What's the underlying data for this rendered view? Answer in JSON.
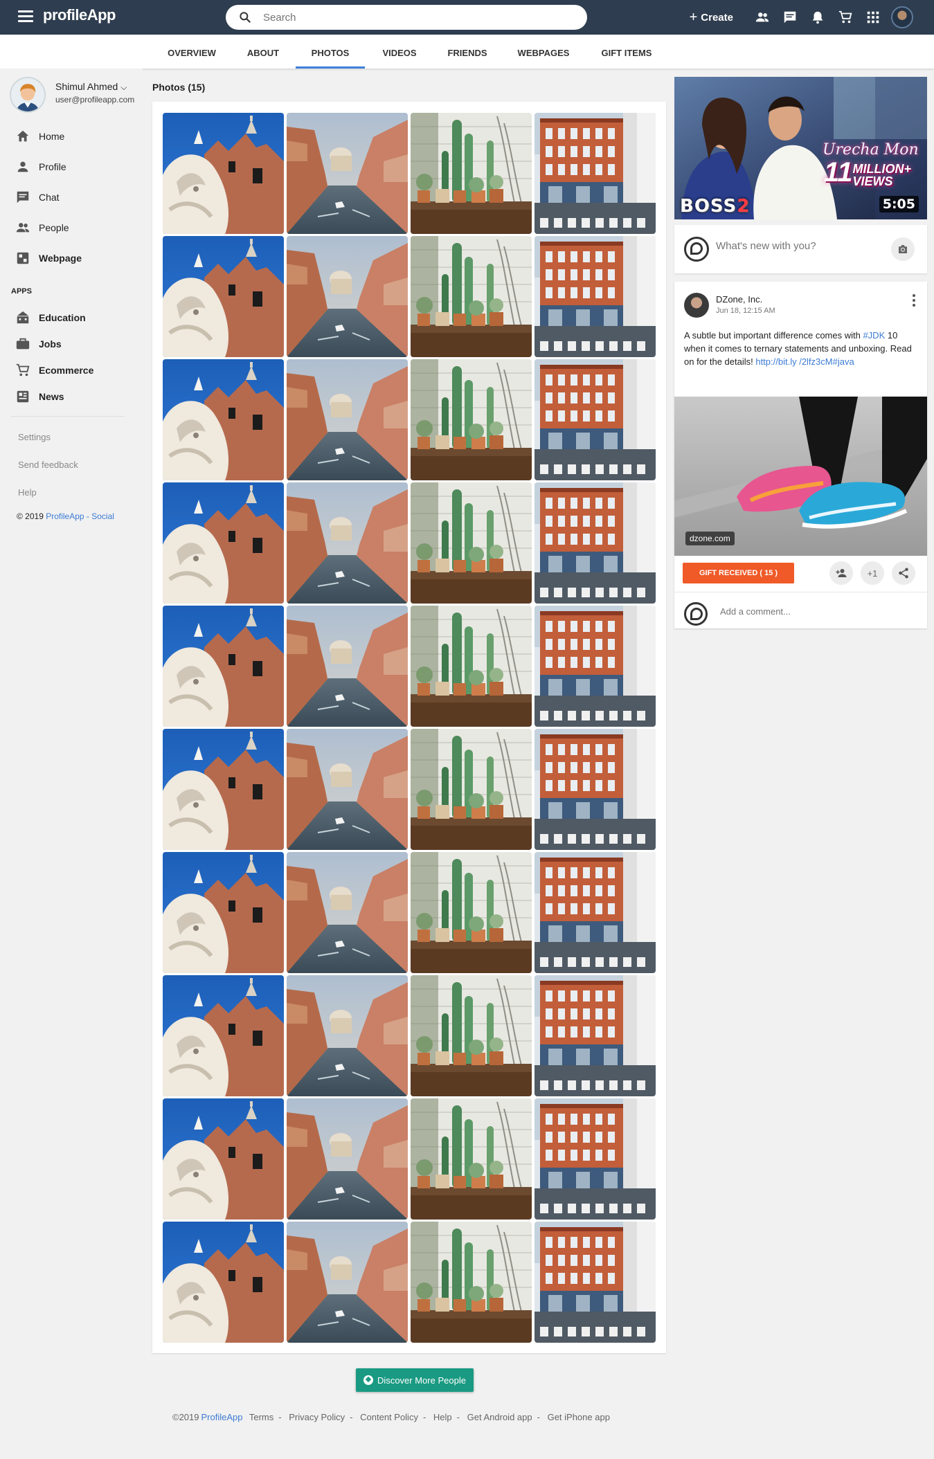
{
  "app": {
    "name": "profileApp"
  },
  "header": {
    "search_placeholder": "Search",
    "create_label": "Create",
    "icons": [
      "people-icon",
      "chat-icon",
      "bell-icon",
      "cart-icon",
      "apps-grid-icon"
    ]
  },
  "tabs": [
    {
      "label": "OVERVIEW"
    },
    {
      "label": "ABOUT"
    },
    {
      "label": "PHOTOS",
      "active": true
    },
    {
      "label": "VIDEOS"
    },
    {
      "label": "FRIENDS"
    },
    {
      "label": "WEBPAGES"
    },
    {
      "label": "GIFT ITEMS"
    }
  ],
  "sidebar": {
    "user": {
      "name": "Shimul Ahmed",
      "email": "user@profileapp.com"
    },
    "nav": [
      {
        "label": "Home",
        "icon": "home-icon"
      },
      {
        "label": "Profile",
        "icon": "person-icon"
      },
      {
        "label": "Chat",
        "icon": "chat-icon"
      },
      {
        "label": "People",
        "icon": "people-icon"
      },
      {
        "label": "Webpage",
        "icon": "webpage-icon"
      }
    ],
    "apps_label": "APPS",
    "apps": [
      {
        "label": "Education",
        "icon": "school-icon"
      },
      {
        "label": "Jobs",
        "icon": "briefcase-icon"
      },
      {
        "label": "Ecommerce",
        "icon": "cart-icon"
      },
      {
        "label": "News",
        "icon": "news-icon"
      }
    ],
    "links": [
      "Settings",
      "Send feedback",
      "Help"
    ],
    "copyright_prefix": "© 2019",
    "copyright_link": "ProfileApp - Social"
  },
  "main": {
    "photos_title": "Photos (15)",
    "photo_themes": [
      "lion-statue",
      "venice-canal",
      "cactus-garden",
      "brick-building"
    ],
    "photo_rows": 10,
    "discover_label": "Discover More People"
  },
  "footer": {
    "copyright": "©2019",
    "brand": "ProfileApp",
    "links": [
      "Terms",
      "Privacy Policy",
      "Content Policy",
      "Help",
      "Get Android app",
      "Get iPhone app"
    ]
  },
  "right": {
    "video": {
      "title": "Urecha Mon",
      "views": "11",
      "views_suffix": "MILLION+ VIEWS",
      "movie": "BOSS",
      "movie_num": "2",
      "duration": "5:05"
    },
    "compose_placeholder": "What's new with you?",
    "post": {
      "author": "DZone, Inc.",
      "date": "Jun 18, 12:15 AM",
      "text_before": "A subtle but important difference comes with ",
      "hashtag_jdk": "#JDK",
      "text_middle": " 10 when it comes to ternary statements and unboxing. Read on for the details! ",
      "link": "http://bit.ly /2lfz3cM",
      "hashtag_java": "#java",
      "image_badge": "dzone.com",
      "gift_button": "GIFT RECEIVED ( 15 )",
      "plus_one": "+1",
      "comment_placeholder": "Add a comment..."
    }
  },
  "colors": {
    "topbar": "#2e3d4f",
    "accent": "#3f7fd9",
    "gift": "#f05a28",
    "discover": "#1a9a82"
  }
}
